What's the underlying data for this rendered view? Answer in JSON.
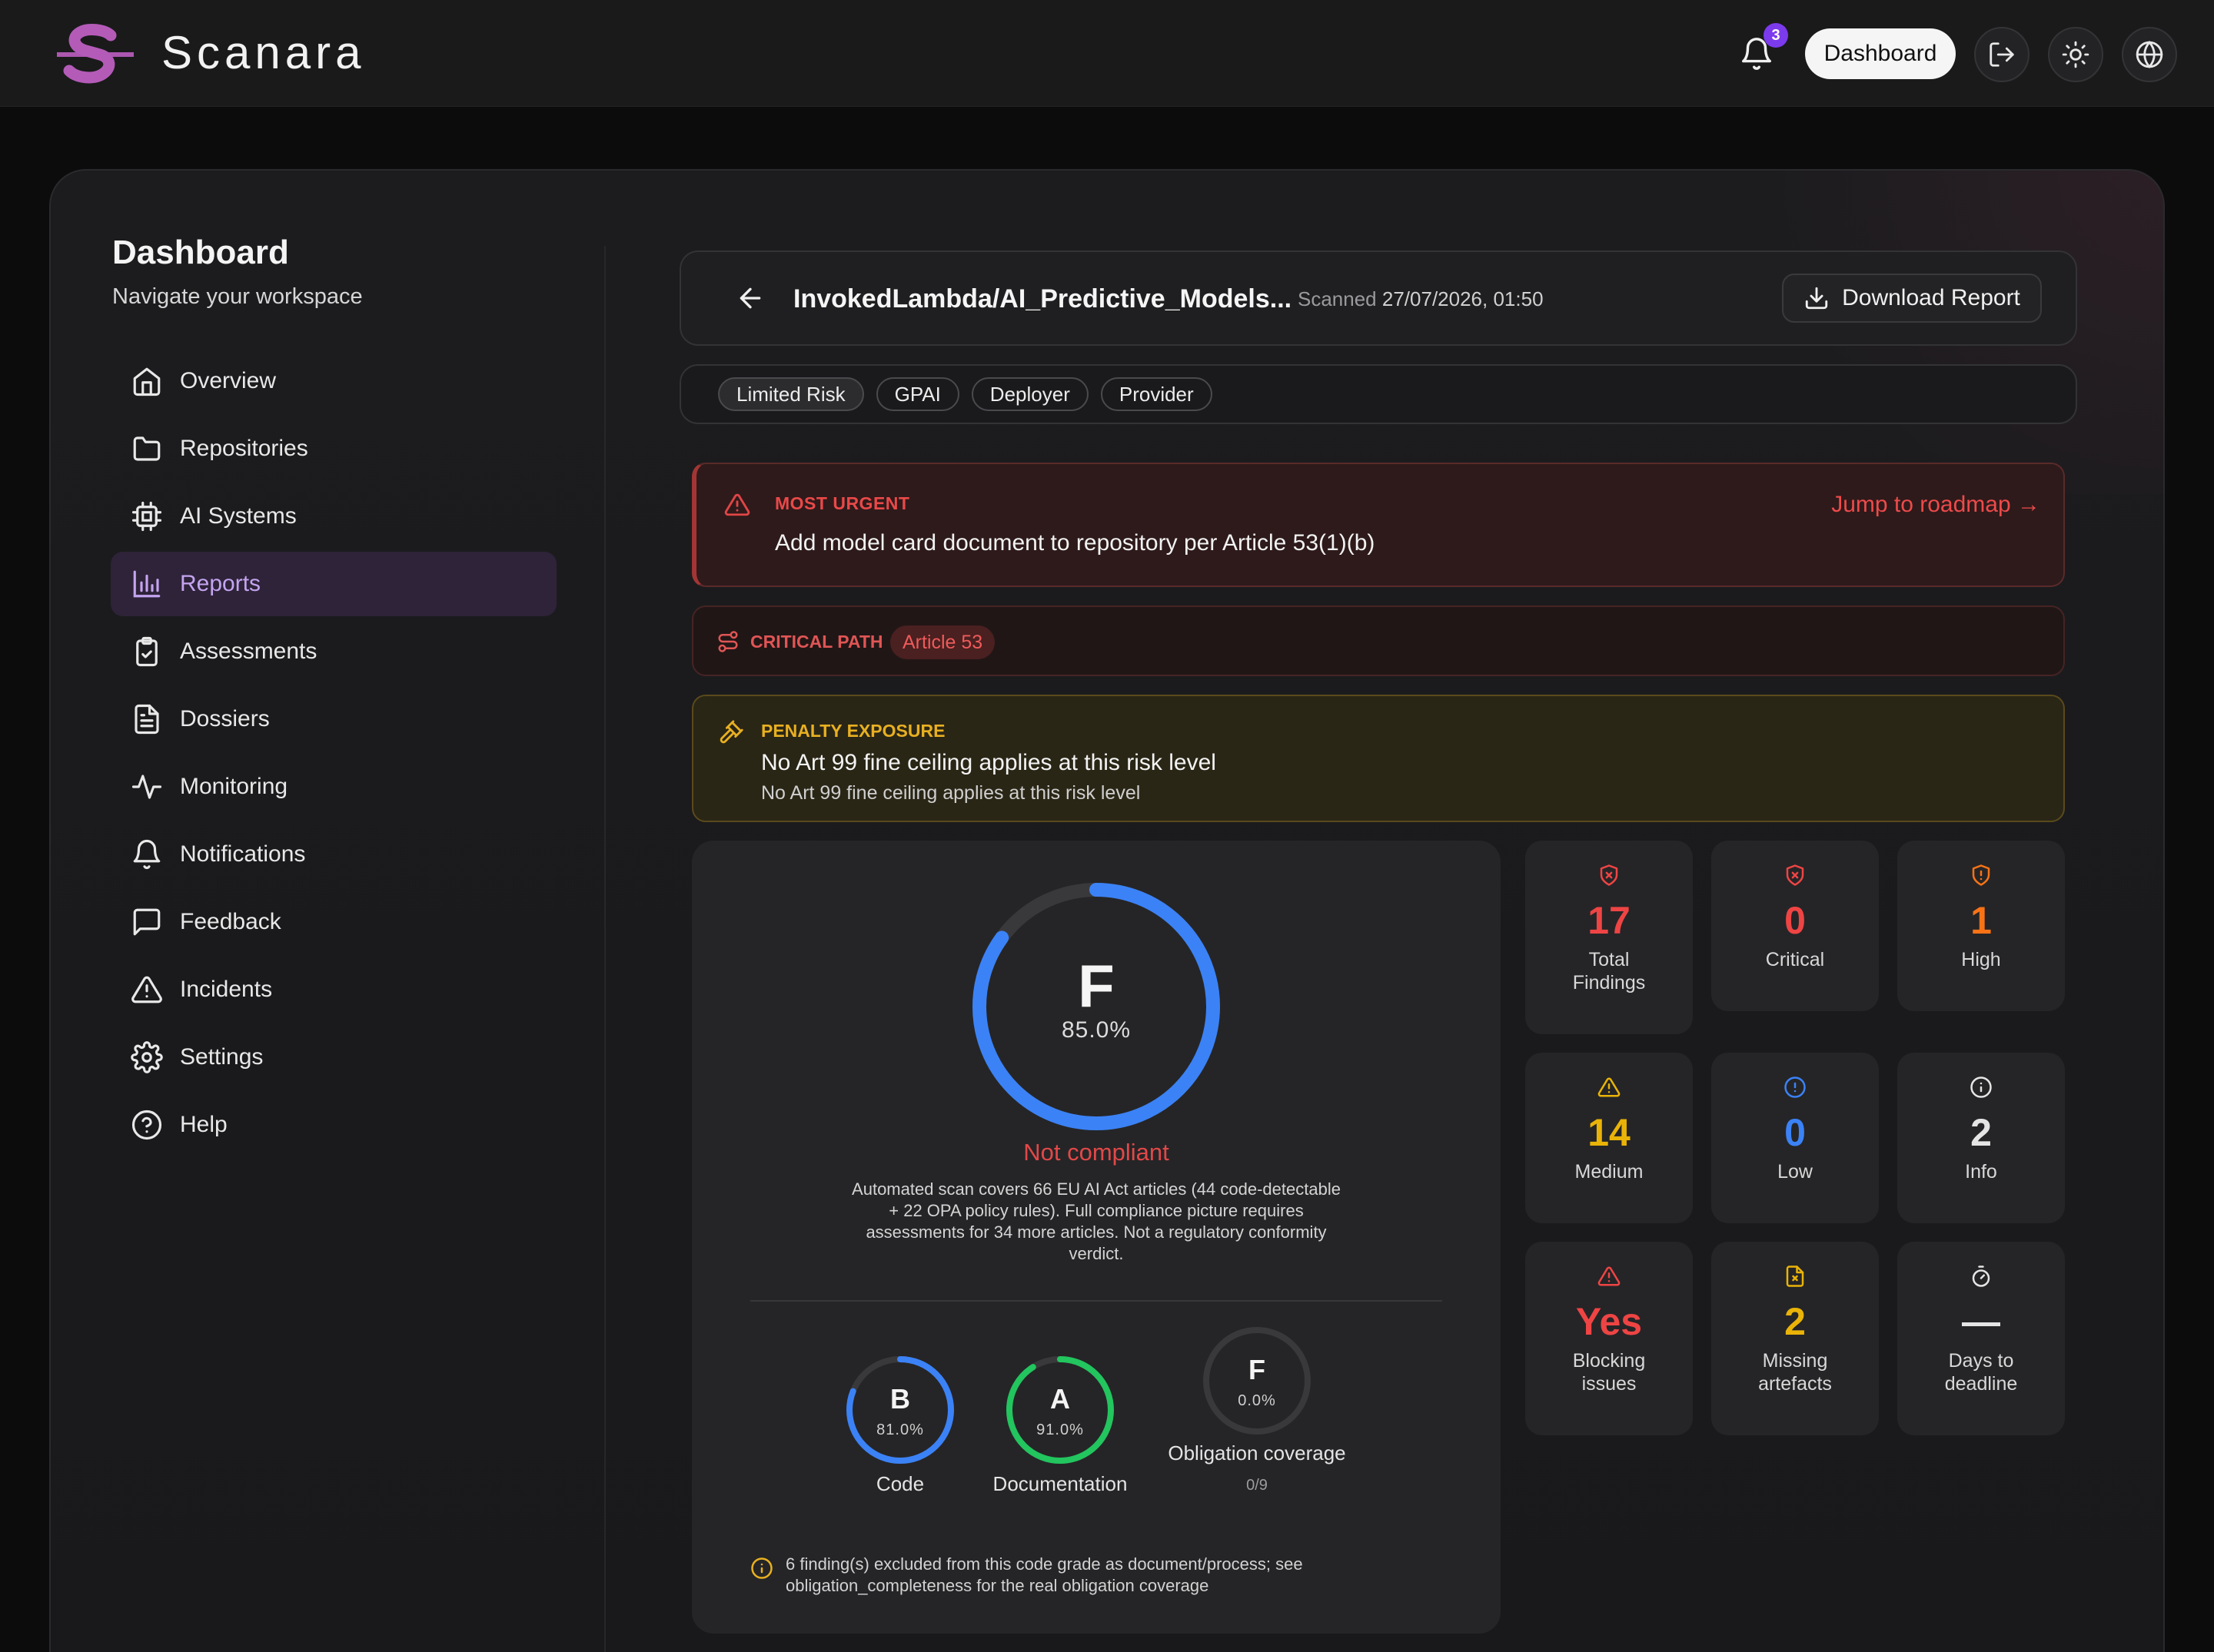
{
  "app": {
    "brand": "Scanara",
    "notification_count": "3",
    "dashboard_button": "Dashboard"
  },
  "sidebar": {
    "title": "Dashboard",
    "subtitle": "Navigate your workspace",
    "items": [
      {
        "label": "Overview",
        "icon": "home-icon"
      },
      {
        "label": "Repositories",
        "icon": "folder-icon"
      },
      {
        "label": "AI Systems",
        "icon": "cpu-icon"
      },
      {
        "label": "Reports",
        "icon": "bar-chart-icon",
        "active": true
      },
      {
        "label": "Assessments",
        "icon": "clipboard-check-icon"
      },
      {
        "label": "Dossiers",
        "icon": "file-text-icon"
      },
      {
        "label": "Monitoring",
        "icon": "activity-icon"
      },
      {
        "label": "Notifications",
        "icon": "bell-icon"
      },
      {
        "label": "Feedback",
        "icon": "message-square-icon"
      },
      {
        "label": "Incidents",
        "icon": "alert-triangle-icon"
      },
      {
        "label": "Settings",
        "icon": "gear-icon"
      },
      {
        "label": "Help",
        "icon": "help-circle-icon"
      }
    ]
  },
  "report": {
    "repo_name": "InvokedLambda/AI_Predictive_Models...",
    "scanned_label": "Scanned",
    "scanned_at": "27/07/2026, 01:50",
    "download_label": "Download Report",
    "tags": [
      "Limited Risk",
      "GPAI",
      "Deployer",
      "Provider"
    ]
  },
  "urgent": {
    "label": "MOST URGENT",
    "text": "Add model card document to repository per Article 53(1)(b)",
    "jump_label": "Jump to roadmap →"
  },
  "critical_path": {
    "label": "CRITICAL PATH",
    "article": "Article 53"
  },
  "penalty": {
    "label": "PENALTY EXPOSURE",
    "title": "No Art 99 fine ceiling applies at this risk level",
    "detail": "No Art 99 fine ceiling applies at this risk level"
  },
  "score": {
    "grade": "F",
    "percent_label": "85.0%",
    "percent_value": 85.0,
    "verdict": "Not compliant",
    "description": "Automated scan covers 66 EU AI Act articles (44 code-detectable + 22 OPA policy rules). Full compliance picture requires assessments for 34 more articles. Not a regulatory conformity verdict.",
    "sub_scores": [
      {
        "grade": "B",
        "percent_label": "81.0%",
        "percent_value": 81.0,
        "label": "Code",
        "color": "#3b82f6"
      },
      {
        "grade": "A",
        "percent_label": "91.0%",
        "percent_value": 91.0,
        "label": "Documentation",
        "color": "#22c55e"
      },
      {
        "grade": "F",
        "percent_label": "0.0%",
        "percent_value": 0.0,
        "label": "Obligation coverage",
        "sub": "0/9",
        "color": "#444447"
      }
    ],
    "note": "6 finding(s) excluded from this code grade as document/process; see obligation_completeness for the real obligation coverage"
  },
  "stats": [
    {
      "value": "17",
      "label": "Total Findings",
      "color": "#ef4444",
      "icon": "shield-x-icon"
    },
    {
      "value": "0",
      "label": "Critical",
      "color": "#ef4444",
      "icon": "shield-x-icon"
    },
    {
      "value": "1",
      "label": "High",
      "color": "#f97316",
      "icon": "shield-alert-icon"
    },
    {
      "value": "14",
      "label": "Medium",
      "color": "#eab308",
      "icon": "alert-triangle-icon"
    },
    {
      "value": "0",
      "label": "Low",
      "color": "#3b82f6",
      "icon": "alert-circle-icon"
    },
    {
      "value": "2",
      "label": "Info",
      "color": "#e5e5e5",
      "icon": "info-icon"
    },
    {
      "value": "Yes",
      "label": "Blocking issues",
      "color": "#ef4444",
      "icon": "alert-triangle-icon"
    },
    {
      "value": "2",
      "label": "Missing artefacts",
      "color": "#eab308",
      "icon": "file-x-icon"
    },
    {
      "value": "—",
      "label": "Days to deadline",
      "color": "#e5e5e5",
      "icon": "timer-icon"
    }
  ]
}
